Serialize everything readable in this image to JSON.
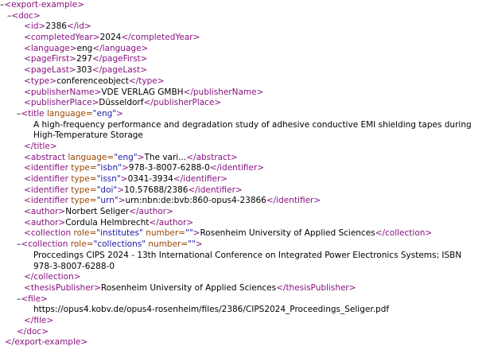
{
  "root_tag": "export-example",
  "doc_tag": "doc",
  "fields": [
    {
      "tag": "id",
      "value": "2386"
    },
    {
      "tag": "completedYear",
      "value": "2024"
    },
    {
      "tag": "language",
      "value": "eng"
    },
    {
      "tag": "pageFirst",
      "value": "297"
    },
    {
      "tag": "pageLast",
      "value": "303"
    },
    {
      "tag": "type",
      "value": "conferenceobject"
    },
    {
      "tag": "publisherName",
      "value": "VDE VERLAG GMBH"
    },
    {
      "tag": "publisherPlace",
      "value": "Düsseldorf"
    }
  ],
  "title": {
    "tag": "title",
    "attr_name": "language",
    "attr_value": "eng",
    "text_line1": "A high-frequency performance and degradation study of adhesive conductive EMI shielding tapes during",
    "text_line2": "High-Temperature Storage"
  },
  "abstract": {
    "tag": "abstract",
    "attr_name": "language",
    "attr_value": "eng",
    "value": "The vari..."
  },
  "identifiers": [
    {
      "tag": "identifier",
      "attr_name": "type",
      "attr_value": "isbn",
      "value": "978-3-8007-6288-0"
    },
    {
      "tag": "identifier",
      "attr_name": "type",
      "attr_value": "issn",
      "value": "0341-3934"
    },
    {
      "tag": "identifier",
      "attr_name": "type",
      "attr_value": "doi",
      "value": "10.57688/2386"
    },
    {
      "tag": "identifier",
      "attr_name": "type",
      "attr_value": "urn",
      "value": "urn:nbn:de:bvb:860-opus4-23866"
    }
  ],
  "authors": [
    {
      "tag": "author",
      "value": "Norbert Seliger"
    },
    {
      "tag": "author",
      "value": "Cordula Helmbrecht"
    }
  ],
  "collection1": {
    "tag": "collection",
    "attr1_name": "role",
    "attr1_value": "institutes",
    "attr2_name": "number",
    "attr2_value": "",
    "value": "Rosenheim University of Applied Sciences"
  },
  "collection2": {
    "tag": "collection",
    "attr1_name": "role",
    "attr1_value": "collections",
    "attr2_name": "number",
    "attr2_value": "",
    "text_line1": "Proccedings CIPS 2024 - 13th International Conference on Integrated Power Electronics Systems; ISBN",
    "text_line2": "978-3-8007-6288-0"
  },
  "thesisPublisher": {
    "tag": "thesisPublisher",
    "value": "Rosenheim University of Applied Sciences"
  },
  "file": {
    "tag": "file",
    "value": "https://opus4.kobv.de/opus4-rosenheim/files/2386/CIPS2024_Proceedings_Seliger.pdf"
  },
  "toggle_symbol": "–"
}
